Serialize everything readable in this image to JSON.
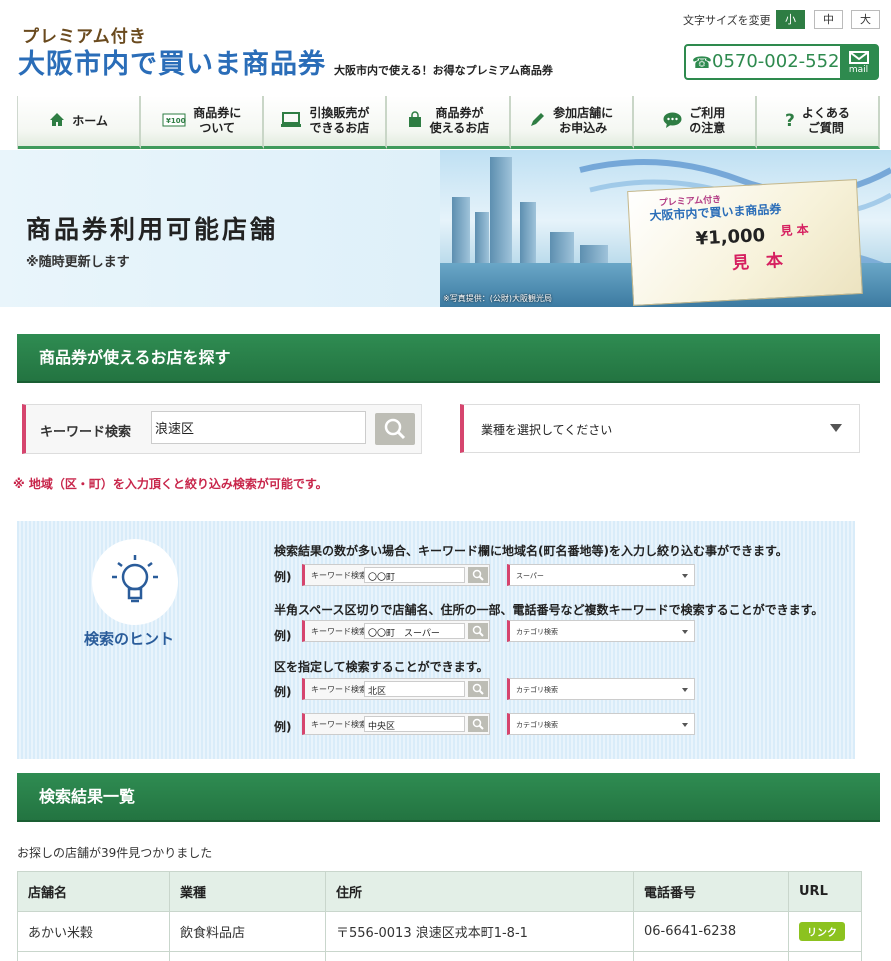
{
  "header": {
    "logo_top": "プレミアム付き",
    "logo_main": "大阪市内で買いま商品券",
    "logo_sub": "大阪市内で使える！お得なプレミアム商品券",
    "font_size_label": "文字サイズを変更",
    "font_sizes": [
      "小",
      "中",
      "大"
    ],
    "phone": "0570-002-552",
    "mail_label": "mail"
  },
  "nav": [
    {
      "label1": "ホーム",
      "label2": "",
      "icon": "home-icon"
    },
    {
      "label1": "商品券に",
      "label2": "ついて",
      "icon": "voucher-icon"
    },
    {
      "label1": "引換販売が",
      "label2": "できるお店",
      "icon": "register-icon"
    },
    {
      "label1": "商品券が",
      "label2": "使えるお店",
      "icon": "bag-icon"
    },
    {
      "label1": "参加店舗に",
      "label2": "お申込み",
      "icon": "pencil-icon"
    },
    {
      "label1": "ご利用",
      "label2": "の注意",
      "icon": "chat-icon"
    },
    {
      "label1": "よくある",
      "label2": "ご質問",
      "icon": "question-icon"
    }
  ],
  "banner": {
    "title": "商品券利用可能店舗",
    "subtitle": "※随時更新します",
    "voucher_top": "プレミアム付き",
    "voucher_title": "大阪市内で買いま商品券",
    "voucher_amount": "¥1,000",
    "voucher_mihon_small": "見 本",
    "voucher_mihon": "見　本",
    "credit": "※写真提供：(公財)大阪観光局"
  },
  "search": {
    "section_title": "商品券が使えるお店を探す",
    "keyword_label": "キーワード検索",
    "keyword_value": "浪速区",
    "category_placeholder": "業種を選択してください",
    "note": "※ 地域（区・町）を入力頂くと絞り込み検索が可能です。"
  },
  "hint": {
    "title": "検索のヒント",
    "examples": [
      {
        "text": "検索結果の数が多い場合、キーワード欄に地域名(町名番地等)を入力し絞り込む事ができます。",
        "ex_label": "例)",
        "kw_label": "キーワード検索",
        "kw_value": "〇〇町",
        "sel_value": "スーパー"
      },
      {
        "text": "半角スペース区切りで店舗名、住所の一部、電話番号など複数キーワードで検索することができます。",
        "ex_label": "例)",
        "kw_label": "キーワード検索",
        "kw_value": "〇〇町　スーパー",
        "sel_value": "カテゴリ検索"
      },
      {
        "text": "区を指定して検索することができます。",
        "ex_label": "例)",
        "kw_label": "キーワード検索",
        "kw_value": "北区",
        "sel_value": "カテゴリ検索"
      },
      {
        "text": "",
        "ex_label": "例)",
        "kw_label": "キーワード検索",
        "kw_value": "中央区",
        "sel_value": "カテゴリ検索"
      }
    ]
  },
  "results": {
    "section_title": "検索結果一覧",
    "count_text": "お探しの店舗が39件見つかりました",
    "columns": [
      "店舗名",
      "業種",
      "住所",
      "電話番号",
      "URL"
    ],
    "rows": [
      {
        "name": "あかい米穀",
        "category": "飲食料品店",
        "address": "〒556-0013 浪速区戎本町1-8-1",
        "phone": "06-6641-6238",
        "url_label": "リンク"
      }
    ]
  }
}
